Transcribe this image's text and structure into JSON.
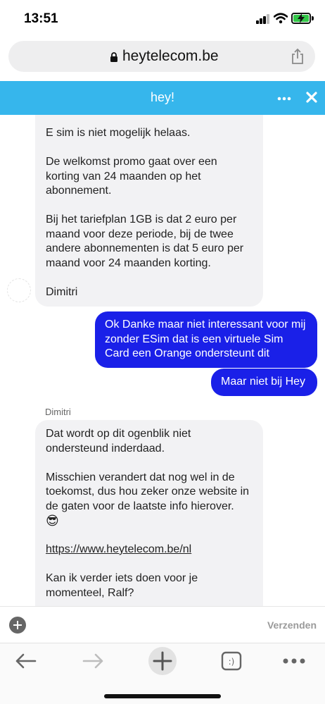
{
  "status_bar": {
    "time": "13:51"
  },
  "browser": {
    "url": "heytelecom.be"
  },
  "chat": {
    "title": "hey!",
    "messages": [
      {
        "from": "agent",
        "paragraphs": [
          "E sim is niet mogelijk helaas.",
          "De welkomst promo gaat over een korting van 24 maanden op het abonnement.",
          "Bij het tariefplan 1GB is dat 2 euro per maand voor deze periode, bij de twee andere abonnementen is dat 5 euro per maand voor 24 maanden korting.",
          "Dimitri"
        ]
      },
      {
        "from": "user",
        "text": "Ok Danke maar niet interessant voor mij zonder ESim dat is een virtuele Sim Card een Orange ondersteunt dit"
      },
      {
        "from": "user",
        "text": "Maar niet bij Hey"
      },
      {
        "from": "agent",
        "sender": "Dimitri",
        "paragraphs": [
          "Dat wordt op dit ogenblik niet ondersteund inderdaad.",
          "Misschien verandert dat nog wel in de toekomst, dus hou zeker onze website in de gaten voor de laatste info hierover.",
          "😎",
          "https://www.heytelecom.be/nl",
          "Kan ik verder iets doen voor je momenteel, Ralf?"
        ]
      }
    ],
    "composer": {
      "send_label": "Verzenden"
    }
  },
  "icons": {
    "signal": "cellular-signal-icon",
    "wifi": "wifi-icon",
    "battery": "battery-charging-icon",
    "lock": "lock-icon",
    "share": "share-icon",
    "more": "more-dots-icon",
    "close": "close-icon",
    "add": "add-attachment-icon",
    "back": "back-arrow-icon",
    "forward": "forward-arrow-icon",
    "new_tab": "plus-icon",
    "tabs": "tabs-icon",
    "menu": "more-menu-icon"
  },
  "colors": {
    "header": "#36b6ec",
    "user_bubble": "#1a20e8",
    "agent_bubble": "#f2f2f4"
  }
}
